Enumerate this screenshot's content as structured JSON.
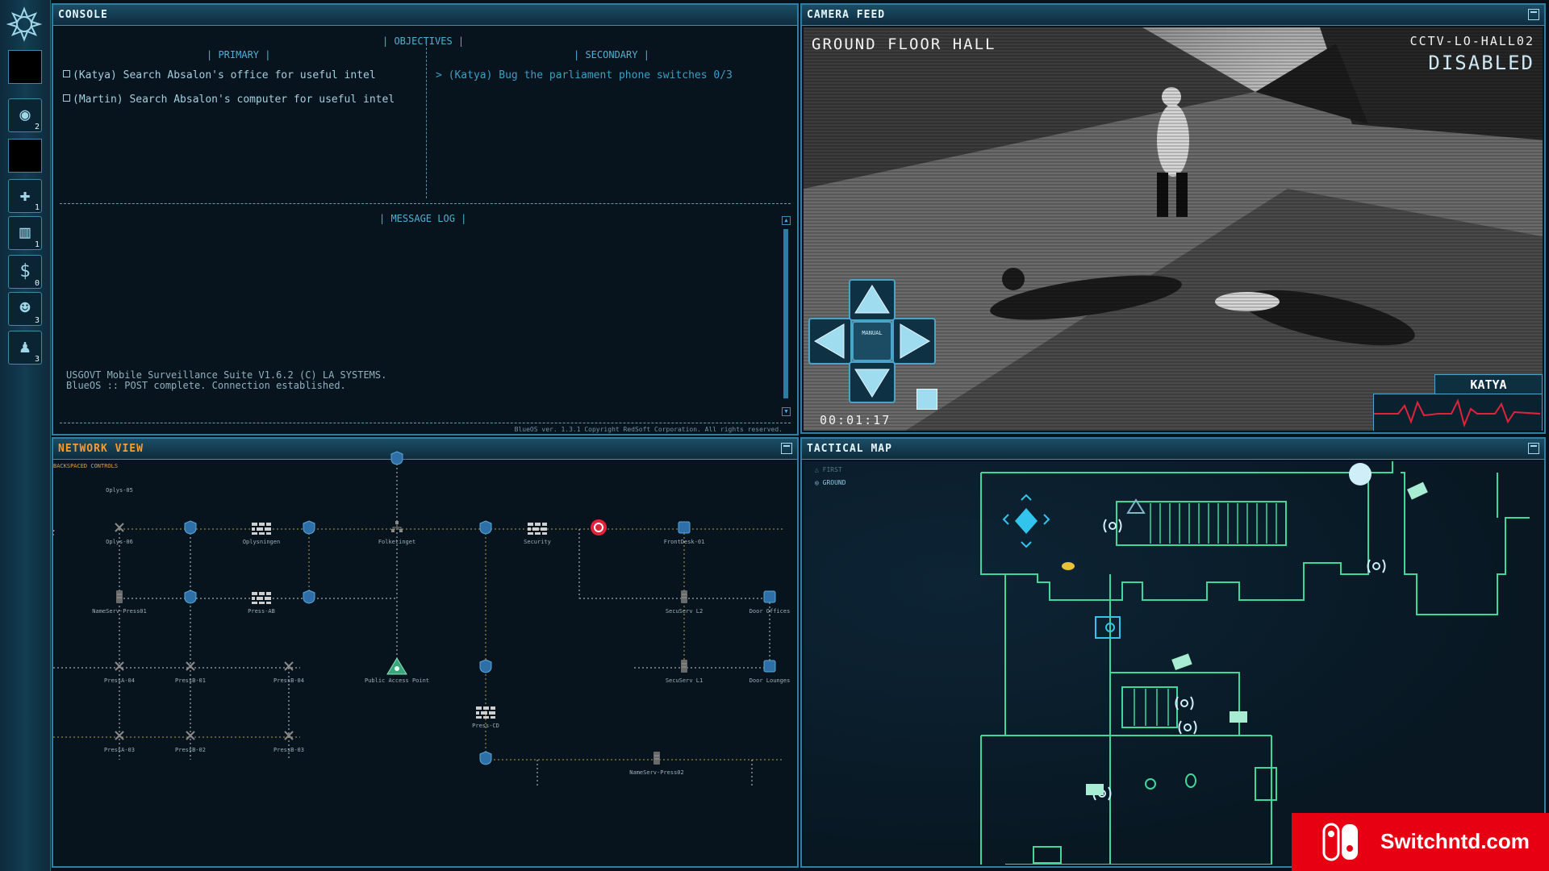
{
  "sidebar": {
    "buttons": [
      {
        "icon": "surveillance-eye-icon",
        "count": "2"
      },
      {
        "icon": "medkit-icon",
        "count": "1"
      },
      {
        "icon": "barricade-icon",
        "count": "1"
      },
      {
        "icon": "money-icon",
        "count": "0"
      },
      {
        "icon": "hacker-head-icon",
        "count": "3"
      },
      {
        "icon": "agent-icon",
        "count": "3"
      }
    ]
  },
  "console": {
    "title": "CONSOLE",
    "objectives_header": "OBJECTIVES",
    "primary_header": "PRIMARY",
    "secondary_header": "SECONDARY",
    "primary": [
      "(Katya) Search Absalon's office for useful intel",
      "(Martin) Search Absalon's computer for useful intel"
    ],
    "secondary": [
      "(Katya) Bug the parliament phone switches 0/3"
    ],
    "message_log_header": "MESSAGE LOG",
    "log_lines": [
      "USGOVT Mobile Surveillance Suite V1.6.2 (C) LA SYSTEMS.",
      "BlueOS :: POST complete. Connection established."
    ],
    "footer": "BlueOS ver. 1.3.1 Copyright RedSoft Corporation. All rights reserved."
  },
  "camera": {
    "title": "CAMERA FEED",
    "location": "GROUND FLOOR HALL",
    "camera_id": "CCTV-LO-HALL02",
    "status": "DISABLED",
    "timer": "00:01:17",
    "dpad_center": "MANUAL",
    "agent_name": "KATYA"
  },
  "network": {
    "title": "NETWORK VIEW",
    "subtitle": "BACKSPACED CONTROLS",
    "nodes": [
      {
        "label": "Oplys-05",
        "kind": "none"
      },
      {
        "label": "Oplys-06",
        "kind": "x"
      },
      {
        "label": "Oplysningen",
        "kind": "wall"
      },
      {
        "label": "Folketinget",
        "kind": "tree"
      },
      {
        "label": "Security",
        "kind": "wall"
      },
      {
        "label": "FrontDesk-01",
        "kind": "screen"
      },
      {
        "label": "NameServ-Press01",
        "kind": "server"
      },
      {
        "label": "Press-AB",
        "kind": "wall"
      },
      {
        "label": "SecuServ L2",
        "kind": "server"
      },
      {
        "label": "Door Offices",
        "kind": "screen"
      },
      {
        "label": "PressA-04",
        "kind": "x"
      },
      {
        "label": "PressB-01",
        "kind": "x"
      },
      {
        "label": "PressB-04",
        "kind": "x"
      },
      {
        "label": "Public Access Point",
        "kind": "access"
      },
      {
        "label": "SecuServ L1",
        "kind": "server"
      },
      {
        "label": "Door Lounges",
        "kind": "screen"
      },
      {
        "label": "Press-CD",
        "kind": "wall"
      },
      {
        "label": "PressA-03",
        "kind": "x"
      },
      {
        "label": "PressB-02",
        "kind": "x"
      },
      {
        "label": "PressB-03",
        "kind": "x"
      },
      {
        "label": "NameServ-Press02",
        "kind": "server"
      }
    ]
  },
  "tactical": {
    "title": "TACTICAL MAP",
    "floors": [
      "FIRST",
      "GROUND"
    ],
    "selected_floor": "GROUND"
  },
  "watermark": {
    "text": "Switchntd.com",
    "color": "#e60012"
  },
  "colors": {
    "accent": "#2f7fa3",
    "map_line": "#3fd89a",
    "node": "#2f6fa8",
    "alert": "#e0233a"
  }
}
